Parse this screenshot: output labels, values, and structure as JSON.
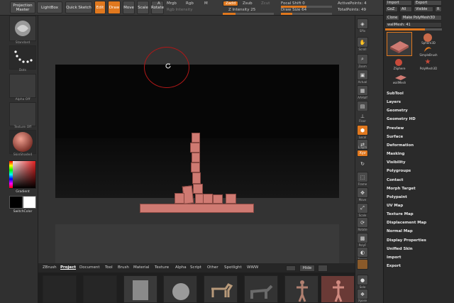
{
  "topbar": {
    "projection_master": "Projection Master",
    "lightbox": "LightBox",
    "quick_sketch": "Quick Sketch",
    "edit": "Edit",
    "draw": "Draw",
    "move": "Move",
    "scale": "Scale",
    "rotate": "Rotate",
    "a": "A",
    "mrgb": "Mrgb",
    "rgb": "Rgb",
    "m": "M",
    "rgb_intensity": "Rgb Intensity",
    "zadd": "Zadd",
    "zsub": "Zsub",
    "zcut": "Zcut",
    "z_intensity": "Z Intensity 25",
    "focal_shift": "Focal Shift 0",
    "draw_size": "Draw Size 64",
    "active_points": "ActivePoints: 4",
    "total_points": "TotalPoints: 49",
    "z_intensity_value": 25,
    "focal_shift_value": 0,
    "draw_size_value": 64
  },
  "left_shelf": {
    "brush_label": "Standard",
    "stroke_label": "Dots",
    "alpha_label": "Alpha Off",
    "texture_label": "Texture Off",
    "material_label": "SkinShade4",
    "gradient_label": "Gradient",
    "switch_color_label": "SwitchColor"
  },
  "right_strip": {
    "spix": "SPix",
    "scroll": "Scroll",
    "zoom": "Zoom",
    "actual": "Actual",
    "aahalf": "AAHalf",
    "persp": "Persp",
    "floor": "Floor",
    "local": "Local",
    "lsym": "L.Sym",
    "xyz": "Xyz",
    "frame": "Frame",
    "move": "Move",
    "scale": "Scale",
    "rotate": "Rotate",
    "polyf": "PolyF",
    "transp": "Transp",
    "solo": "Solo",
    "xpose": "Xpose"
  },
  "tool_panel": {
    "import": "Import",
    "export": "Export",
    "goz": "GoZ",
    "all": "All",
    "visible": "Visible",
    "r": "R",
    "clone": "Clone",
    "make_polymesh": "Make PolyMesh3D",
    "current_tool": "wallMesh: 41",
    "tools": [
      {
        "label": "Sphere3D"
      },
      {
        "label": "SimpleBrush"
      },
      {
        "label": "ZSphere"
      },
      {
        "label": "PolyMesh3D"
      },
      {
        "label": "wallMesh"
      }
    ],
    "menu": [
      "SubTool",
      "Layers",
      "Geometry",
      "Geometry HD",
      "Preview",
      "Surface",
      "Deformation",
      "Masking",
      "Visibility",
      "Polygroups",
      "Contact",
      "Morph Target",
      "Polypaint",
      "UV Map",
      "Texture Map",
      "Displacement Map",
      "Normal Map",
      "Display Properties",
      "Unified Skin",
      "Import",
      "Export"
    ]
  },
  "bottom": {
    "tabs": [
      "ZBrush",
      "Project",
      "Document",
      "Tool",
      "Brush",
      "Material",
      "Texture",
      "Alpha",
      "Script",
      "Other",
      "Spotlight",
      "WWW"
    ],
    "selected_tab": "Project",
    "hide_label": "Hide"
  },
  "colors": {
    "accent": "#e0781e",
    "model": "#cf7a72",
    "canvas": "#050505"
  }
}
